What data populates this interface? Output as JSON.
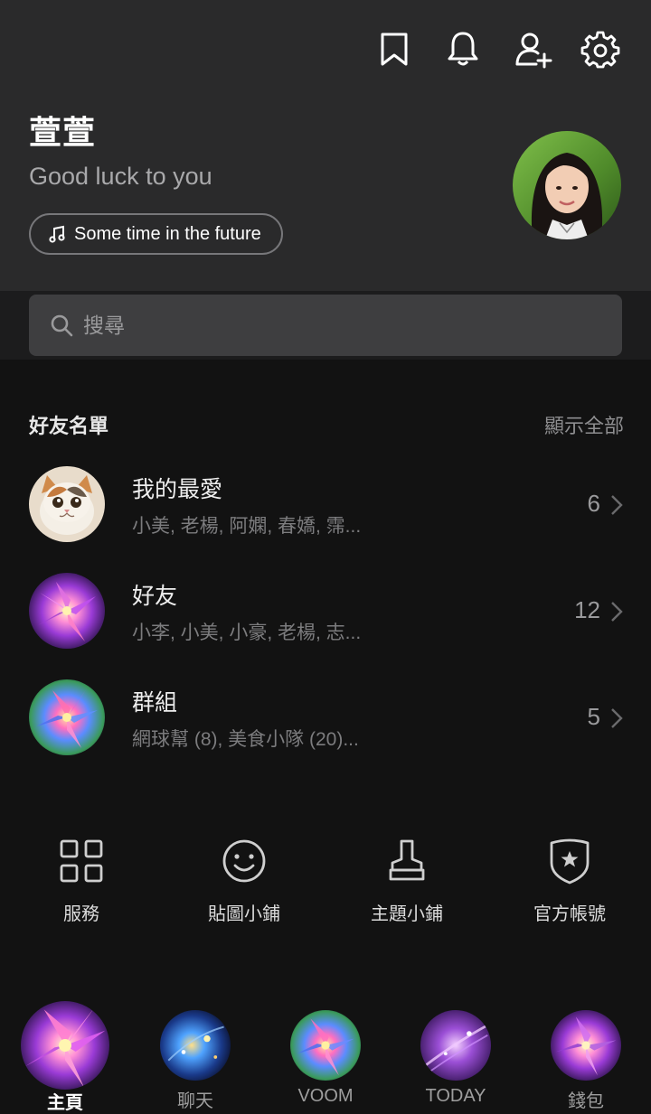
{
  "profile": {
    "name": "萱萱",
    "status_message": "Good luck to you",
    "music": "Some time in the future"
  },
  "header_icons": [
    "bookmark-icon",
    "bell-icon",
    "add-friend-icon",
    "gear-icon"
  ],
  "search": {
    "placeholder": "搜尋"
  },
  "friends_section": {
    "title": "好友名單",
    "show_all": "顯示全部",
    "items": [
      {
        "name": "我的最愛",
        "members": "小美, 老楊, 阿嫻, 春嬌, 霈...",
        "count": "6"
      },
      {
        "name": "好友",
        "members": "小李, 小美, 小豪, 老楊, 志...",
        "count": "12"
      },
      {
        "name": "群組",
        "members": "網球幫 (8), 美食小隊 (20)...",
        "count": "5"
      }
    ]
  },
  "quick_actions": [
    {
      "label": "服務",
      "icon": "grid-icon"
    },
    {
      "label": "貼圖小鋪",
      "icon": "smiley-icon"
    },
    {
      "label": "主題小鋪",
      "icon": "brush-icon"
    },
    {
      "label": "官方帳號",
      "icon": "shield-star-icon"
    }
  ],
  "bottom_tabs": [
    {
      "label": "主頁",
      "active": true
    },
    {
      "label": "聊天",
      "active": false
    },
    {
      "label": "VOOM",
      "active": false
    },
    {
      "label": "TODAY",
      "active": false
    },
    {
      "label": "錢包",
      "active": false
    }
  ],
  "colors": {
    "header_bg": "#2a2a2b",
    "page_bg": "#121212",
    "search_bg": "#3e3e40",
    "muted_text": "#7c7c7e"
  }
}
